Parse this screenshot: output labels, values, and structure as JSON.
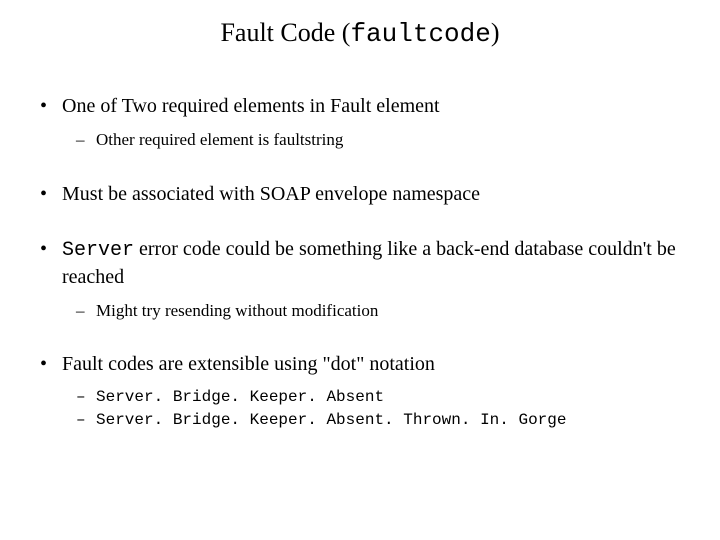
{
  "title": {
    "prefix": "Fault Code (",
    "code": "faultcode",
    "suffix": ")"
  },
  "bullets": [
    {
      "text": "One of Two required elements in Fault element",
      "sub": [
        {
          "text": "Other required element is faultstring"
        }
      ]
    },
    {
      "text": "Must be associated with SOAP envelope namespace"
    },
    {
      "code_prefix": "Server",
      "rest": " error code could be something like a back-end database couldn't be reached",
      "sub": [
        {
          "text": "Might try resending without modification"
        }
      ]
    },
    {
      "text": "Fault codes are extensible using \"dot\" notation",
      "sub_mono": [
        {
          "text": "Server. Bridge. Keeper. Absent"
        },
        {
          "text": "Server. Bridge. Keeper. Absent. Thrown. In. Gorge"
        }
      ]
    }
  ]
}
